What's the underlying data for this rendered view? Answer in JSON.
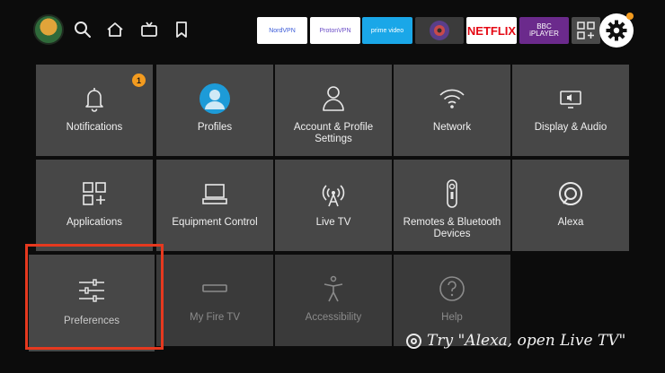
{
  "topbar": {
    "apps": {
      "nord": "NordVPN",
      "proton": "ProtonVPN",
      "prime": "prime video",
      "netflix": "NETFLIX",
      "bbc_line1": "BBC",
      "bbc_line2": "iPLAYER"
    }
  },
  "settings": {
    "notifications": {
      "label": "Notifications",
      "badge": "1"
    },
    "profiles": "Profiles",
    "account": "Account & Profile Settings",
    "network": "Network",
    "display": "Display & Audio",
    "applications": "Applications",
    "equipment": "Equipment Control",
    "livetv": "Live TV",
    "remotes": "Remotes & Bluetooth Devices",
    "alexa": "Alexa",
    "preferences": "Preferences",
    "myfiretv": "My Fire TV",
    "accessibility": "Accessibility",
    "help": "Help"
  },
  "tip": "Try \"Alexa, open Live TV\"",
  "colors": {
    "accent": "#f39b1f",
    "selection": "#e6391f",
    "tile": "#474747",
    "tile_dim": "#3a3a3a"
  }
}
